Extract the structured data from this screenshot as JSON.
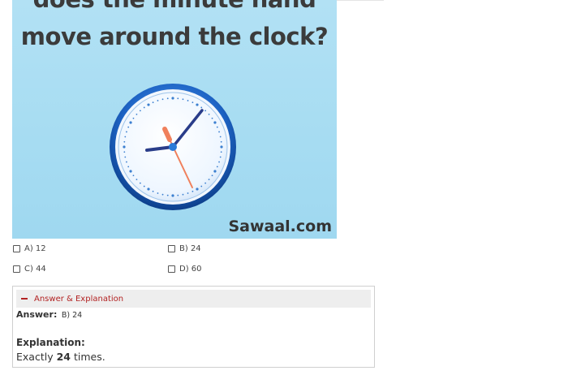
{
  "question_image": {
    "line1": "does the minute hand",
    "line2": "move around the clock?",
    "watermark": "Sawaal.com"
  },
  "options": {
    "a": "A) 12",
    "b": "B) 24",
    "c": "C) 44",
    "d": "D) 60"
  },
  "answer_section": {
    "toggle_title": "Answer & Explanation",
    "answer_label": "Answer:",
    "answer_value": "B) 24",
    "explanation_label": "Explanation:",
    "explanation_prefix": "Exactly ",
    "explanation_number": "24",
    "explanation_suffix": " times."
  },
  "colors": {
    "image_background": "#a6dcf2",
    "accent_red": "#b22222",
    "clock_rim": "#1d63c4",
    "second_hand": "#f0805c"
  }
}
